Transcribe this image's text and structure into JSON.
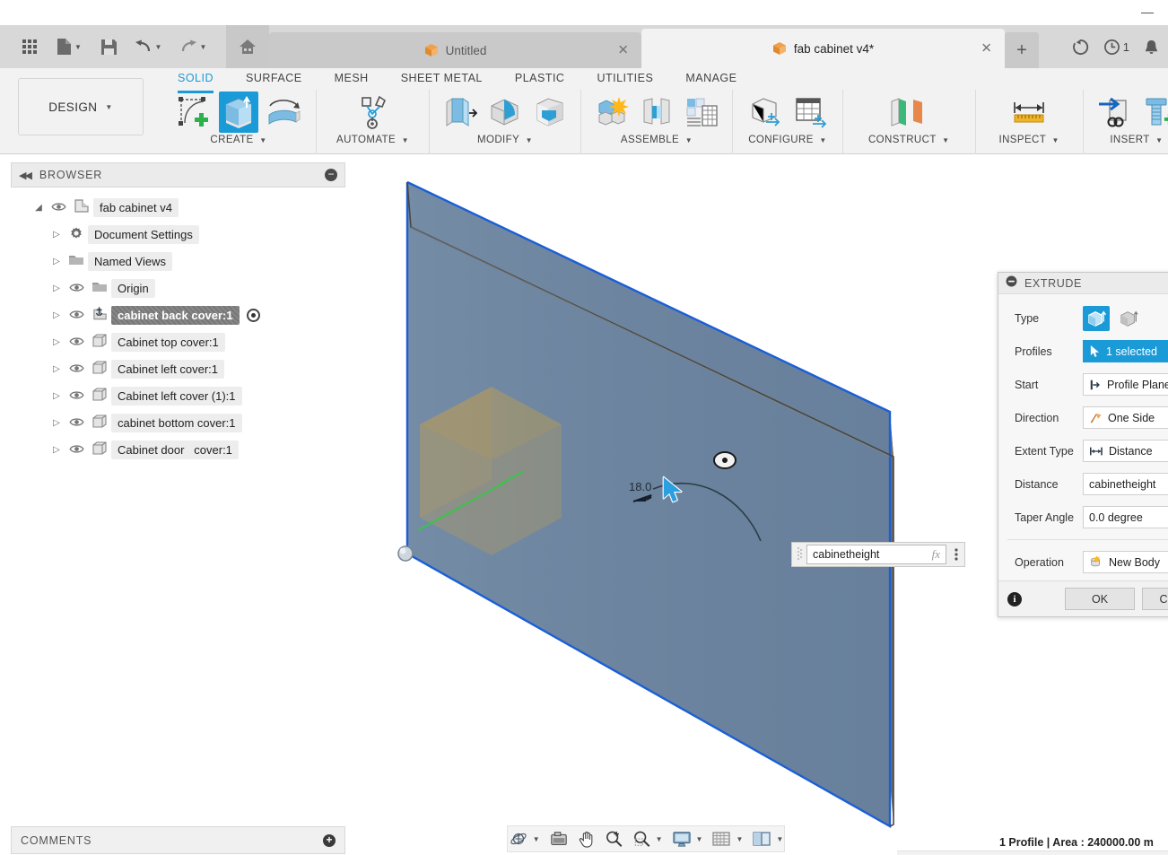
{
  "window": {
    "minimize_label": "—"
  },
  "quick_access": {
    "items": [
      {
        "name": "app-grid",
        "icon": "grid-icon",
        "label": ""
      },
      {
        "name": "new-document",
        "icon": "file-icon",
        "label": "",
        "caret": "▼"
      },
      {
        "name": "save",
        "icon": "save-icon",
        "label": ""
      },
      {
        "name": "undo",
        "icon": "undo-icon",
        "label": "",
        "caret": "▼"
      },
      {
        "name": "redo",
        "icon": "redo-icon",
        "label": "",
        "caret": "▼"
      },
      {
        "name": "home",
        "icon": "home-icon",
        "label": ""
      }
    ]
  },
  "tabs": {
    "documents": [
      {
        "title": "Untitled",
        "active": false,
        "close": "✕"
      },
      {
        "title": "fab cabinet v4*",
        "active": true,
        "close": "✕"
      }
    ],
    "new_tab_label": "+"
  },
  "top_right": {
    "refresh_icon": "refresh-icon",
    "job_status_icon": "clock-icon",
    "job_status_count": "1",
    "notifications_icon": "bell-icon"
  },
  "ribbon": {
    "workspace": {
      "label": "DESIGN",
      "caret": "▼"
    },
    "tabs": [
      {
        "label": "SOLID",
        "active": true
      },
      {
        "label": "SURFACE",
        "active": false
      },
      {
        "label": "MESH",
        "active": false
      },
      {
        "label": "SHEET METAL",
        "active": false
      },
      {
        "label": "PLASTIC",
        "active": false
      },
      {
        "label": "UTILITIES",
        "active": false
      },
      {
        "label": "MANAGE",
        "active": false
      }
    ],
    "panels": [
      {
        "label": "CREATE",
        "caret": "▼",
        "icons": [
          "sketch-create-icon",
          "extrude-icon",
          "revolve-icon"
        ]
      },
      {
        "label": "AUTOMATE",
        "caret": "▼",
        "icons": [
          "automate-icon"
        ]
      },
      {
        "label": "MODIFY",
        "caret": "▼",
        "icons": [
          "press-pull-icon",
          "fillet-icon",
          "shell-icon"
        ]
      },
      {
        "label": "ASSEMBLE",
        "caret": "▼",
        "icons": [
          "new-component-icon",
          "joint-icon",
          "bom-icon"
        ]
      },
      {
        "label": "CONFIGURE",
        "caret": "▼",
        "icons": [
          "configure-body-icon",
          "configure-table-icon"
        ]
      },
      {
        "label": "CONSTRUCT",
        "caret": "▼",
        "icons": [
          "construct-plane-icon"
        ]
      },
      {
        "label": "INSPECT",
        "caret": "▼",
        "icons": [
          "measure-icon"
        ]
      },
      {
        "label": "INSERT",
        "caret": "▼",
        "icons": [
          "insert-derive-icon",
          "insert-mcmaster-icon"
        ]
      }
    ]
  },
  "browser": {
    "header": "BROWSER",
    "collapse_icon": "collapse-left-icon",
    "minimize_icon": "minus-circle-icon",
    "tree": [
      {
        "label": "fab cabinet v4",
        "indent": 0,
        "twist": "◢",
        "eye": true,
        "icon": "document-icon",
        "selected": false,
        "radio": false
      },
      {
        "label": "Document Settings",
        "indent": 1,
        "twist": "▷",
        "eye": false,
        "icon": "gear-icon",
        "selected": false,
        "radio": false
      },
      {
        "label": "Named Views",
        "indent": 1,
        "twist": "▷",
        "eye": false,
        "icon": "folder-icon",
        "selected": false,
        "radio": false
      },
      {
        "label": "Origin",
        "indent": 1,
        "twist": "▷",
        "eye": true,
        "icon": "folder-icon",
        "selected": false,
        "radio": false
      },
      {
        "label": "cabinet back cover:1",
        "indent": 1,
        "twist": "▷",
        "eye": true,
        "icon": "component-anchor-icon",
        "selected": true,
        "radio": true
      },
      {
        "label": "Cabinet top cover:1",
        "indent": 1,
        "twist": "▷",
        "eye": true,
        "icon": "body-icon",
        "selected": false,
        "radio": false
      },
      {
        "label": "Cabinet left cover:1",
        "indent": 1,
        "twist": "▷",
        "eye": true,
        "icon": "body-icon",
        "selected": false,
        "radio": false
      },
      {
        "label": "Cabinet left cover (1):1",
        "indent": 1,
        "twist": "▷",
        "eye": true,
        "icon": "body-icon",
        "selected": false,
        "radio": false
      },
      {
        "label": "cabinet bottom cover:1",
        "indent": 1,
        "twist": "▷",
        "eye": true,
        "icon": "body-icon",
        "selected": false,
        "radio": false
      },
      {
        "label": "Cabinet door   cover:1",
        "indent": 1,
        "twist": "▷",
        "eye": true,
        "icon": "body-icon",
        "selected": false,
        "radio": false
      }
    ]
  },
  "comments": {
    "header": "COMMENTS",
    "add_icon": "plus-circle-icon"
  },
  "extrude_dialog": {
    "title": "EXTRUDE",
    "collapse_icon": "minus-circle-icon",
    "type": {
      "label": "Type",
      "option_a_icon": "extrude-solid-icon",
      "option_b_icon": "extrude-thin-icon",
      "selected": "a"
    },
    "profiles": {
      "label": "Profiles",
      "value": "1 selected",
      "icon": "cursor-select-icon"
    },
    "start": {
      "label": "Start",
      "value": "Profile Plane",
      "icon": "profile-plane-icon"
    },
    "direction": {
      "label": "Direction",
      "value": "One Side",
      "icon": "one-side-icon"
    },
    "extent_type": {
      "label": "Extent Type",
      "value": "Distance",
      "icon": "distance-icon"
    },
    "distance": {
      "label": "Distance",
      "value": "cabinetheight"
    },
    "taper_angle": {
      "label": "Taper Angle",
      "value": "0.0 degree"
    },
    "operation": {
      "label": "Operation",
      "value": "New Body",
      "icon": "new-body-icon"
    },
    "buttons": {
      "info_icon": "info-icon",
      "ok": "OK",
      "cancel": "Cancel"
    }
  },
  "canvas": {
    "dimension_label": "18.0",
    "value_input": {
      "value": "cabinetheight",
      "placeholder": "cabinetheight",
      "fx_label": "fx",
      "menu_icon": "more-vertical-icon"
    },
    "cursor_icon": "arrow-cursor-icon",
    "colors": {
      "body_face": "#6b84a0",
      "body_edge_highlight": "#1a5fd6",
      "body_side": "#6f6c66",
      "origin_plane": "#c8a04a"
    }
  },
  "nav_toolbar": {
    "items": [
      {
        "name": "orbit",
        "icon": "orbit-icon",
        "caret": "▼"
      },
      {
        "name": "look-at",
        "icon": "look-at-icon",
        "caret": ""
      },
      {
        "name": "pan",
        "icon": "pan-hand-icon",
        "caret": ""
      },
      {
        "name": "zoom",
        "icon": "zoom-in-icon",
        "caret": ""
      },
      {
        "name": "zoom-window",
        "icon": "zoom-window-icon",
        "caret": "▼"
      },
      {
        "name": "display-settings",
        "icon": "monitor-icon",
        "caret": "▼"
      },
      {
        "name": "grid-snaps",
        "icon": "grid-icon",
        "caret": "▼"
      },
      {
        "name": "viewports",
        "icon": "viewports-icon",
        "caret": "▼"
      }
    ]
  },
  "status_bar": {
    "text": "1 Profile | Area : 240000.00 m"
  }
}
